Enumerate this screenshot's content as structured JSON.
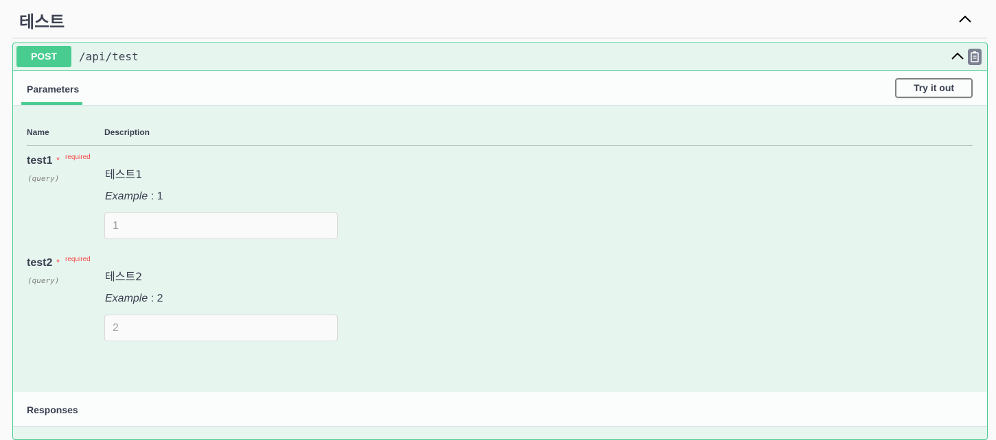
{
  "tag": {
    "title": "테스트",
    "toggle_icon": "chevron-up-icon"
  },
  "operation": {
    "method": "POST",
    "path": "/api/test",
    "method_color": "#49cc90",
    "collapse_icon": "chevron-up-icon",
    "copy_icon": "clipboard-icon"
  },
  "parameters": {
    "tab_label": "Parameters",
    "try_button": "Try it out",
    "columns": {
      "name": "Name",
      "description": "Description"
    },
    "items": [
      {
        "name": "test1",
        "required_star": "*",
        "required_label": "required",
        "location": "(query)",
        "description": "테스트1",
        "example_label": "Example",
        "example_sep": " : 1",
        "input_value": "",
        "input_placeholder": "1"
      },
      {
        "name": "test2",
        "required_star": "*",
        "required_label": "required",
        "location": "(query)",
        "description": "테스트2",
        "example_label": "Example",
        "example_sep": " : 2",
        "input_value": "",
        "input_placeholder": "2"
      }
    ]
  },
  "responses": {
    "label": "Responses"
  }
}
